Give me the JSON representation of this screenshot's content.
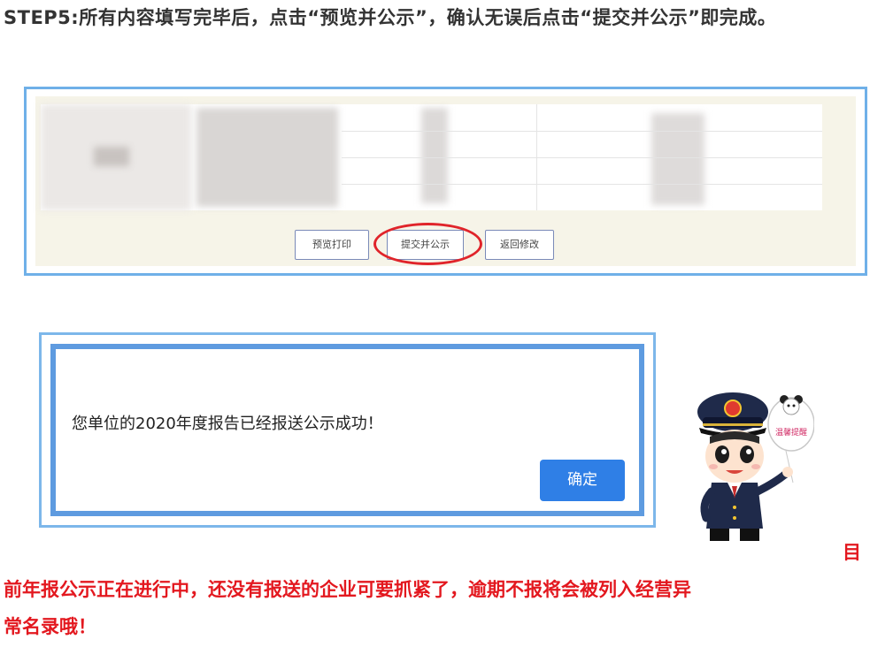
{
  "step_text": "STEP5:所有内容填写完毕后，点击“预览并公示”，确认无误后点击“提交并公示”即完成。",
  "report_buttons": {
    "preview_print": "预览打印",
    "submit_publish": "提交并公示",
    "back_modify": "返回修改"
  },
  "dialog": {
    "message": "您单位的2020年度报告已经报送公示成功！",
    "confirm": "确定"
  },
  "mascot_sign": "温馨提醒",
  "reminder": {
    "line1": "目",
    "line2": "前年报公示正在进行中，还没有报送的企业可要抓紧了，逾期不报将会被列入经营异",
    "line3": "常名录哦！"
  },
  "colors": {
    "accent_red": "#e3181f",
    "frame_blue": "#6fb0e8",
    "button_blue": "#2f7fe6"
  }
}
